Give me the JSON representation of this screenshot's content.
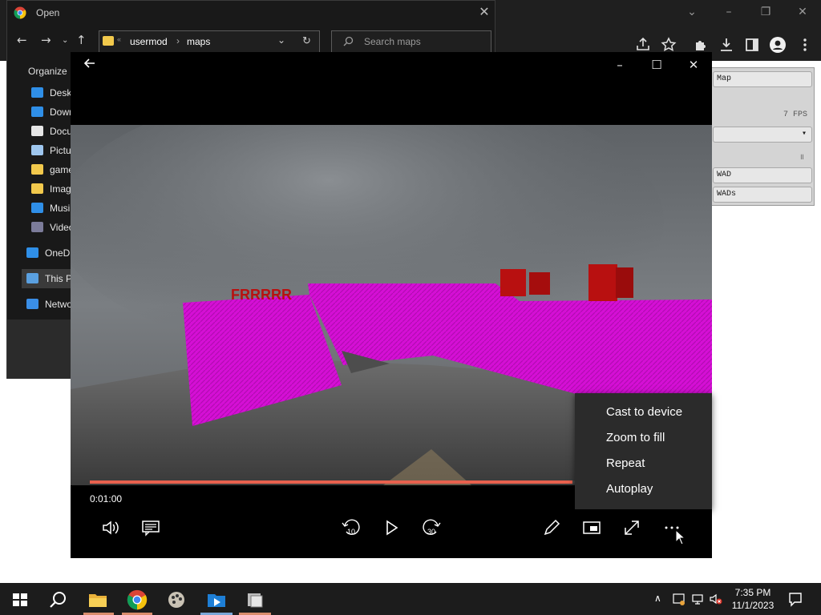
{
  "open_dialog": {
    "title": "Open",
    "path": [
      "usermod",
      "maps"
    ],
    "search_placeholder": "Search maps",
    "organize_label": "Organize",
    "sidebar_items": [
      {
        "label": "Deskt",
        "icon": "desktop-icon"
      },
      {
        "label": "Down",
        "icon": "download-icon"
      },
      {
        "label": "Docu",
        "icon": "document-icon"
      },
      {
        "label": "Pictu",
        "icon": "pictures-icon"
      },
      {
        "label": "game",
        "icon": "folder-icon"
      },
      {
        "label": "Imag",
        "icon": "folder-icon"
      },
      {
        "label": "Musi",
        "icon": "music-icon"
      },
      {
        "label": "Video",
        "icon": "video-icon"
      },
      {
        "label": "OneDr",
        "icon": "onedrive-icon"
      },
      {
        "label": "This PC",
        "icon": "this-pc-icon"
      },
      {
        "label": "Netwo",
        "icon": "network-icon"
      }
    ]
  },
  "settings_panel": {
    "btn_top": "Map",
    "fps_label": "7 FPS",
    "btn_wad": "WAD",
    "btn_wads": "WADs"
  },
  "player": {
    "current_time": "0:01:00",
    "progress": 0.8,
    "skip_back_seconds": "10",
    "skip_forward_seconds": "30",
    "banner_text": "FRRRRR",
    "menu_items": [
      "Cast to device",
      "Zoom to fill",
      "Repeat",
      "Autoplay"
    ]
  },
  "taskbar": {
    "time": "7:35 PM",
    "date": "11/1/2023"
  },
  "colors": {
    "accent_progress": "#e8614e",
    "magenta_walls": "#d50fd5",
    "red_cubes": "#b81010"
  }
}
